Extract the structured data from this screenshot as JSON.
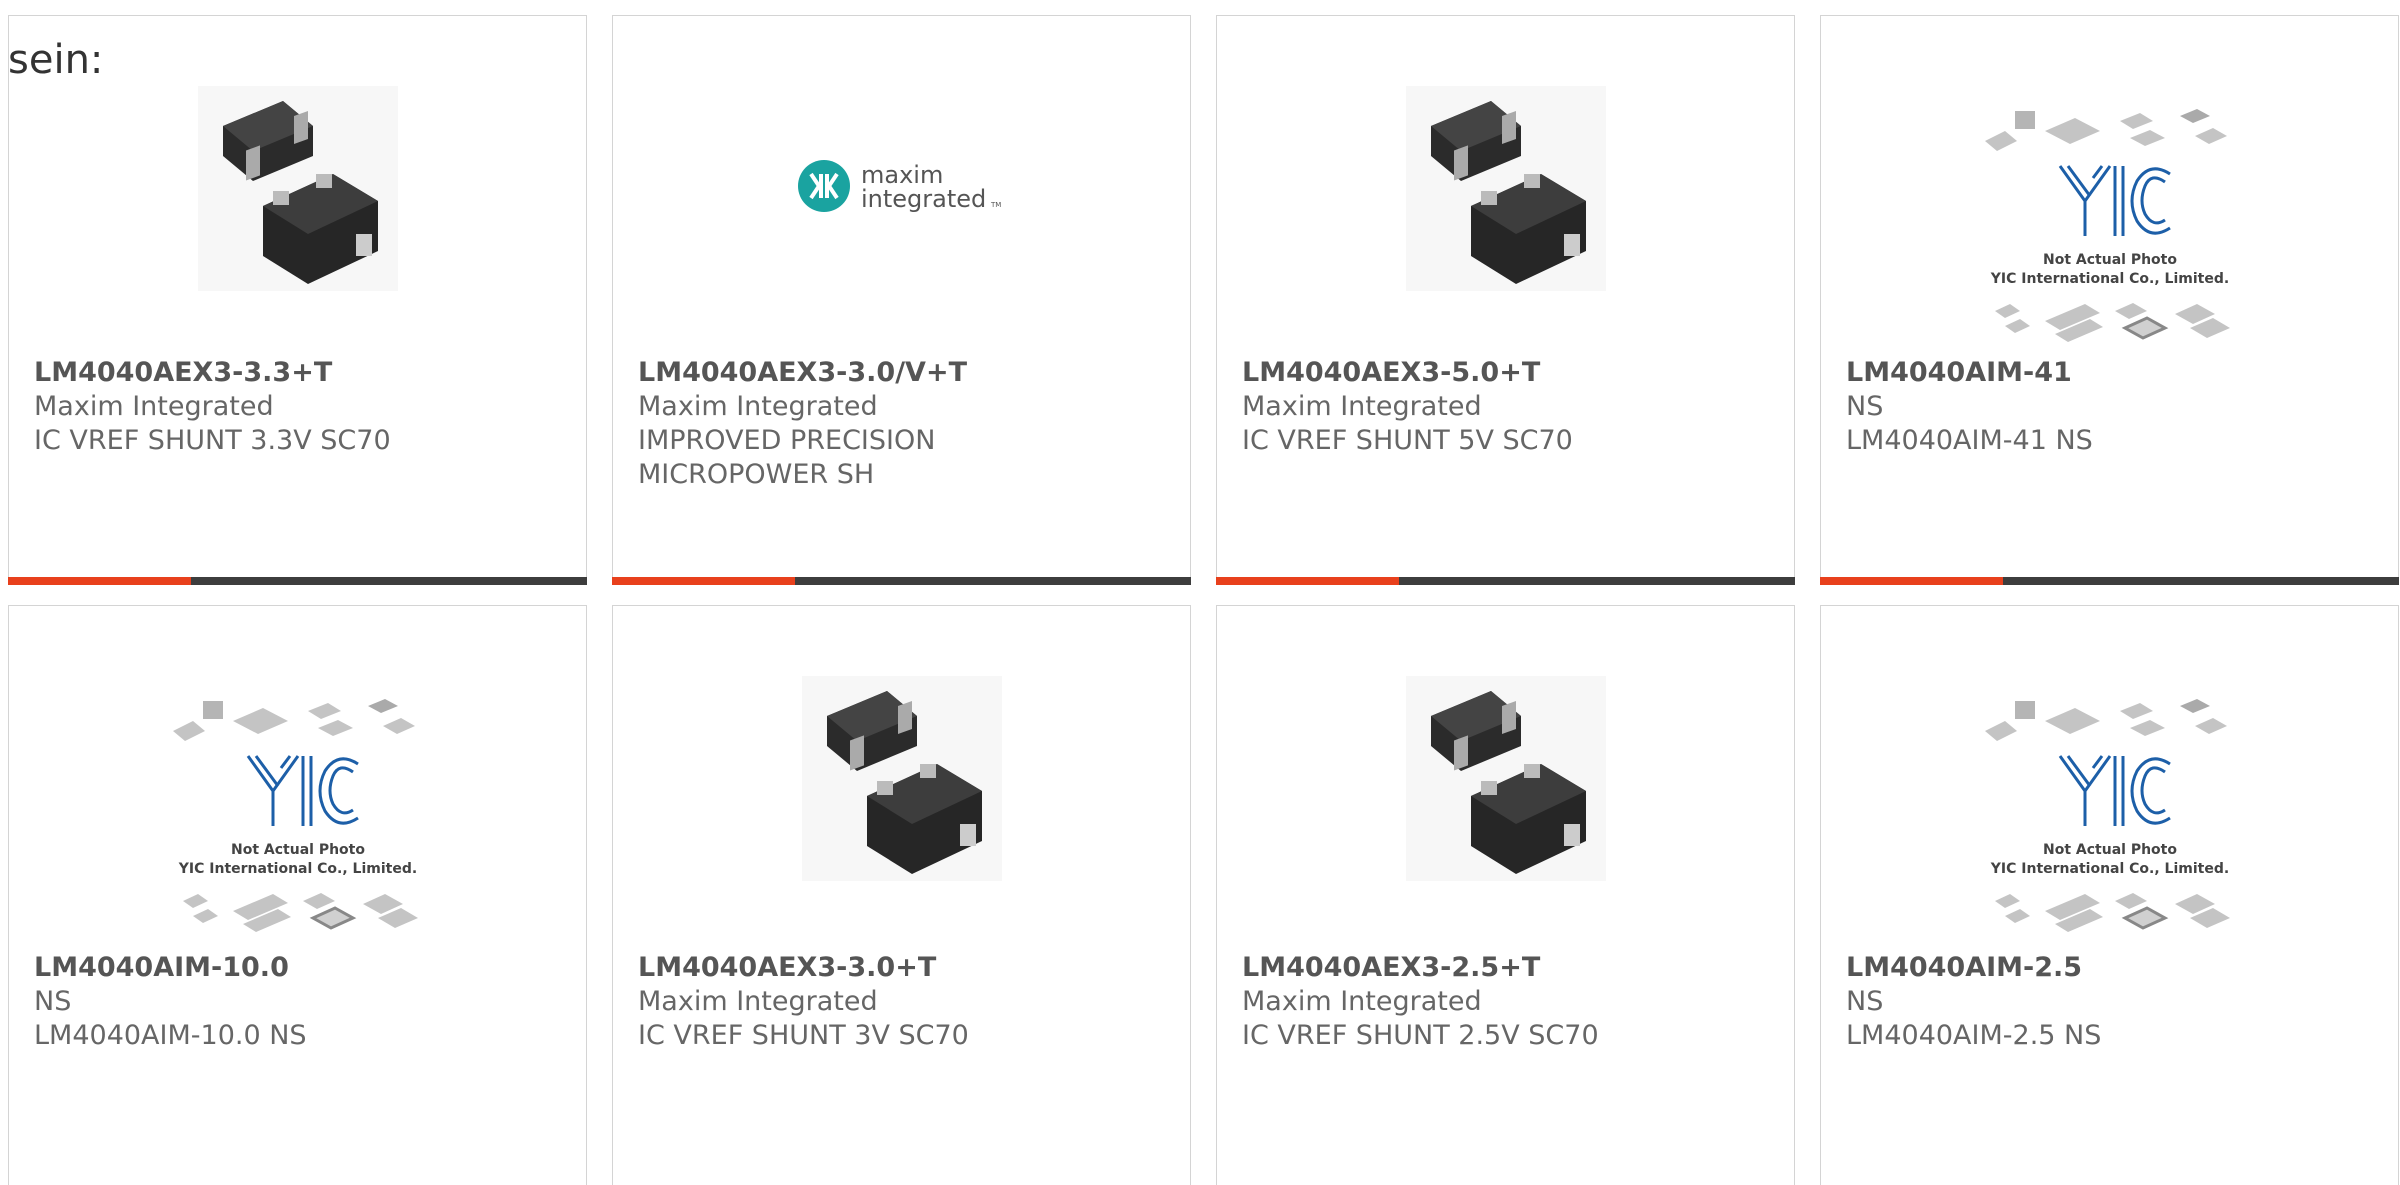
{
  "page": {
    "prefix_text": "sein:"
  },
  "colors": {
    "accent": "#e8401c",
    "bar": "#3d3d3d",
    "logo_teal": "#1aa3a0",
    "yic_blue": "#1d5fa8"
  },
  "products": [
    {
      "part": "LM4040AEX3-3.3+T",
      "maker": "Maxim Integrated",
      "desc": "IC VREF SHUNT 3.3V SC70",
      "image": "sc70-chip-photo"
    },
    {
      "part": "LM4040AEX3-3.0/V+T",
      "maker": "Maxim Integrated",
      "desc": "IMPROVED PRECISION MICROPOWER SH",
      "image": "maxim-integrated-logo",
      "logo_line1": "maxim",
      "logo_line2": "integrated",
      "logo_tm": "TM"
    },
    {
      "part": "LM4040AEX3-5.0+T",
      "maker": "Maxim Integrated",
      "desc": "IC VREF SHUNT 5V SC70",
      "image": "sc70-chip-photo"
    },
    {
      "part": "LM4040AIM-41",
      "maker": "NS",
      "desc": "LM4040AIM-41 NS",
      "image": "yic-placeholder",
      "placeholder_line1": "Not Actual Photo",
      "placeholder_line2": "YIC International Co., Limited."
    },
    {
      "part": "LM4040AIM-10.0",
      "maker": "NS",
      "desc": "LM4040AIM-10.0 NS",
      "image": "yic-placeholder",
      "placeholder_line1": "Not Actual Photo",
      "placeholder_line2": "YIC International Co., Limited."
    },
    {
      "part": "LM4040AEX3-3.0+T",
      "maker": "Maxim Integrated",
      "desc": "IC VREF SHUNT 3V SC70",
      "image": "sc70-chip-photo"
    },
    {
      "part": "LM4040AEX3-2.5+T",
      "maker": "Maxim Integrated",
      "desc": "IC VREF SHUNT 2.5V SC70",
      "image": "sc70-chip-photo"
    },
    {
      "part": "LM4040AIM-2.5",
      "maker": "NS",
      "desc": "LM4040AIM-2.5 NS",
      "image": "yic-placeholder",
      "placeholder_line1": "Not Actual Photo",
      "placeholder_line2": "YIC International Co., Limited."
    }
  ]
}
